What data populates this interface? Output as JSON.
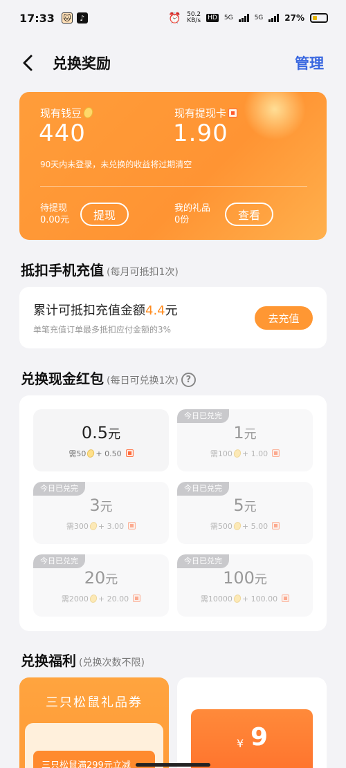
{
  "status_bar": {
    "time": "17:33",
    "net_speed_top": "50.2",
    "net_speed_bottom": "KB/s",
    "signal1": "5G",
    "signal2": "5G",
    "battery": "27%",
    "hd": "HD"
  },
  "header": {
    "title": "兑换奖励",
    "manage": "管理"
  },
  "balance": {
    "beans_label": "现有钱豆",
    "beans_value": "440",
    "card_label": "现有提现卡",
    "card_value": "1.90",
    "note": "90天内未登录，未兑换的收益将过期清空",
    "pending_label": "待提现",
    "pending_value": "0.00元",
    "withdraw_button": "提现",
    "gift_label": "我的礼品",
    "gift_value": "0份",
    "view_button": "查看"
  },
  "recharge": {
    "section_title": "抵扣手机充值",
    "section_sub": "(每月可抵扣1次)",
    "main_prefix": "累计可抵扣充值金额",
    "amount": "4.4",
    "unit": "元",
    "note": "单笔充值订单最多抵扣应付金额的3%",
    "button": "去充值"
  },
  "red_packet": {
    "section_title": "兑换现金红包",
    "section_sub": "(每日可兑换1次)",
    "help": "?",
    "done_tag": "今日已兑完",
    "yuan": "元",
    "need": "需",
    "tiles": [
      {
        "amount": "0.5",
        "beans": "50",
        "plus": "+ 0.50",
        "done": false
      },
      {
        "amount": "1",
        "beans": "100",
        "plus": "+ 1.00",
        "done": true
      },
      {
        "amount": "3",
        "beans": "300",
        "plus": "+ 3.00",
        "done": true
      },
      {
        "amount": "5",
        "beans": "500",
        "plus": "+ 5.00",
        "done": true
      },
      {
        "amount": "20",
        "beans": "2000",
        "plus": "+ 20.00",
        "done": true
      },
      {
        "amount": "100",
        "beans": "10000",
        "plus": "+ 100.00",
        "done": true
      }
    ]
  },
  "welfare": {
    "section_title": "兑换福利",
    "section_sub": "(兑换次数不限)",
    "left_title": "三只松鼠礼品券",
    "left_pill": "三只松鼠满299元立减",
    "right_currency": "¥",
    "right_value": "9"
  },
  "colors": {
    "accent_orange": "#ff9733",
    "manage_blue": "#3a68e0",
    "highlight": "#ff8a1c"
  }
}
